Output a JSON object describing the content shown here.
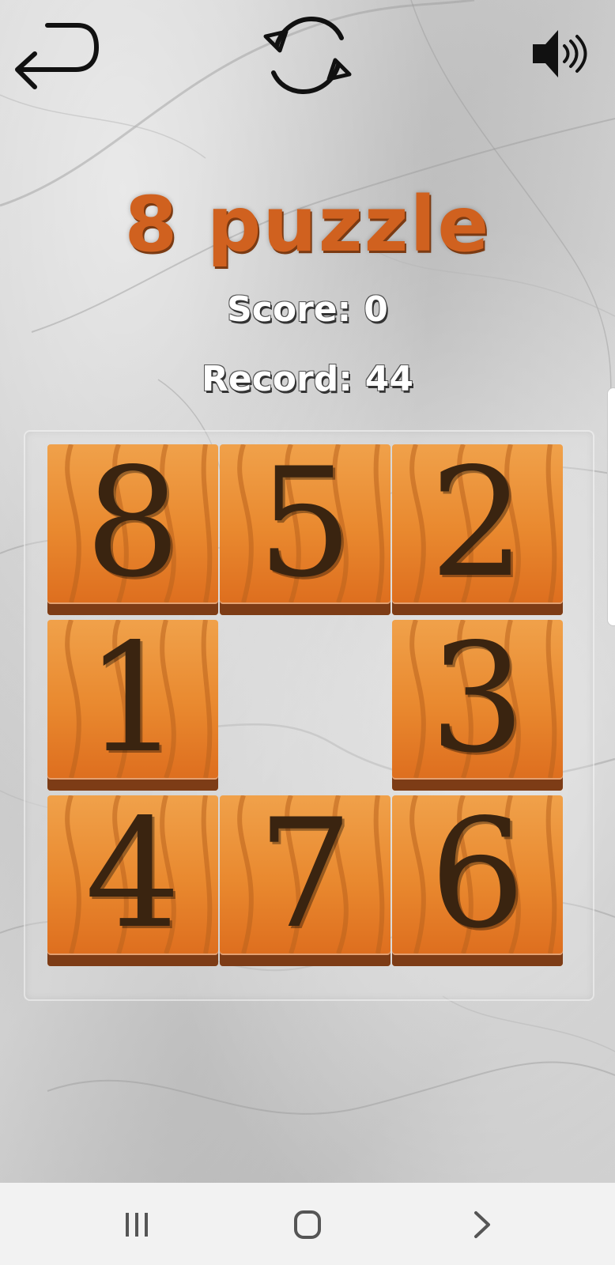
{
  "header": {
    "back_icon": "undo-arrow-icon",
    "restart_icon": "restart-icon",
    "sound_icon": "speaker-on-icon"
  },
  "title": "8 puzzle",
  "score": {
    "label": "Score:",
    "value": "0"
  },
  "record": {
    "label": "Record:",
    "value": "44"
  },
  "board": {
    "rows": [
      [
        "8",
        "5",
        "2"
      ],
      [
        "1",
        "",
        "3"
      ],
      [
        "4",
        "7",
        "6"
      ]
    ]
  },
  "nav": {
    "recents_icon": "recent-apps-icon",
    "home_icon": "home-icon",
    "back_icon": "back-chevron-icon"
  },
  "colors": {
    "title": "#d0611f",
    "tile_top": "#f0a14a",
    "tile_bottom": "#dc6a1c",
    "digit": "#3a2410"
  }
}
